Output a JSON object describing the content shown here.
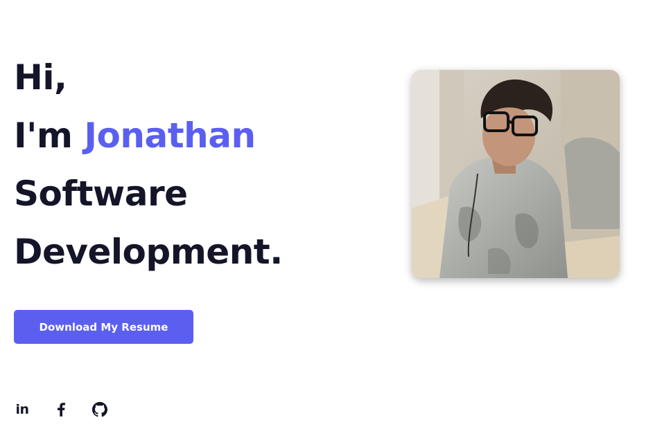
{
  "hero": {
    "line1": "Hi,",
    "line2_prefix": "I'm ",
    "line2_name": "Jonathan",
    "line3": "Software",
    "line4": "Development."
  },
  "cta": {
    "label": "Download My Resume"
  },
  "social": [
    {
      "name": "linkedin",
      "glyph": "in",
      "icon": "linkedin-icon"
    },
    {
      "name": "facebook",
      "icon": "facebook-icon"
    },
    {
      "name": "github",
      "icon": "github-icon"
    }
  ],
  "colors": {
    "accent": "#5b5ff0",
    "text": "#141529",
    "background": "#ffffff"
  },
  "portrait": {
    "icon": "profile-photo"
  }
}
